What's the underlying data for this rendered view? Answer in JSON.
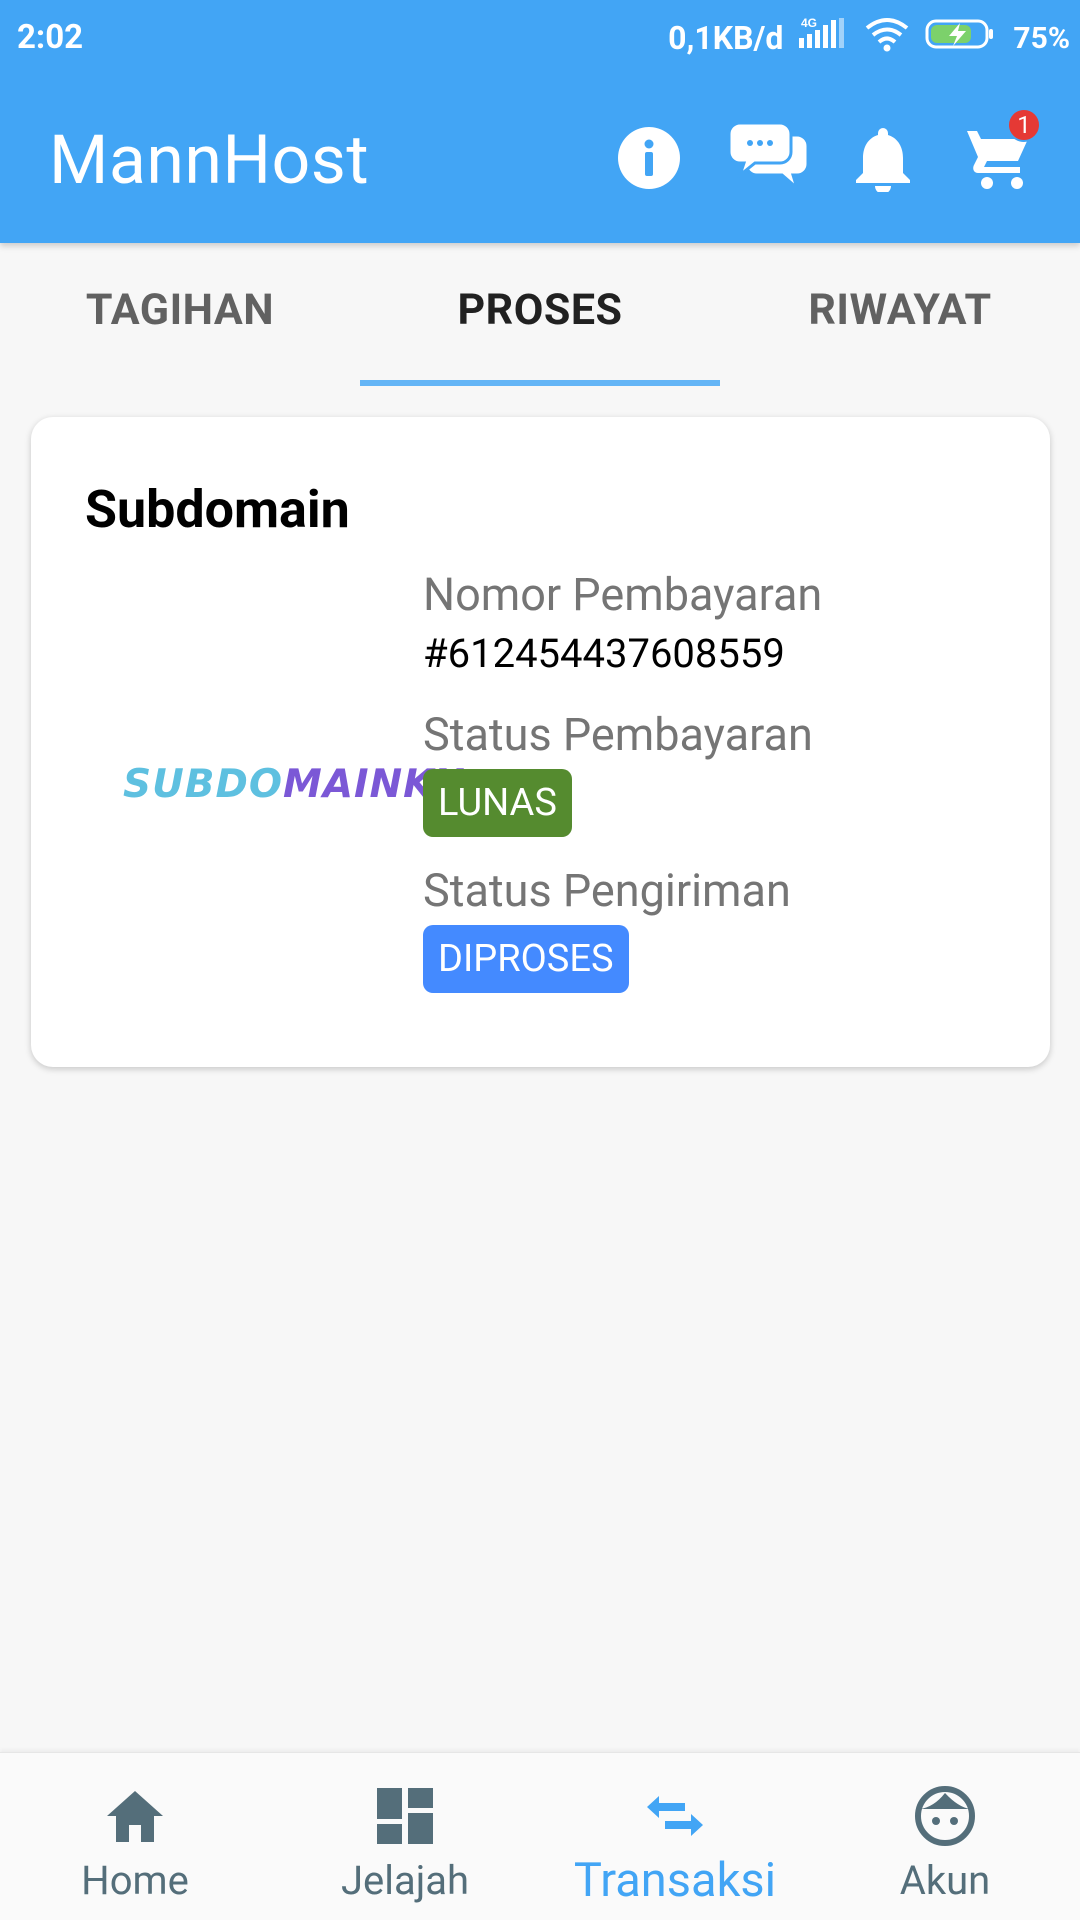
{
  "status_bar": {
    "time": "2:02",
    "network_speed": "0,1KB/d",
    "network_type": "4G",
    "battery_percent": "75%",
    "icons": [
      "signal-icon",
      "wifi-icon",
      "battery-charging-icon"
    ]
  },
  "app_bar": {
    "title": "MannHost",
    "cart_badge": "1",
    "icons": [
      "info-icon",
      "chat-icon",
      "bell-icon",
      "cart-icon"
    ]
  },
  "tabs": [
    {
      "label": "TAGIHAN",
      "active": false
    },
    {
      "label": "PROSES",
      "active": true
    },
    {
      "label": "RIWAYAT",
      "active": false
    }
  ],
  "card": {
    "title": "Subdomain",
    "logo_part1": "SUBDO",
    "logo_part2": "MAINKU",
    "payment_number_label": "Nomor Pembayaran",
    "payment_number": "#612454437608559",
    "payment_status_label": "Status Pembayaran",
    "payment_status": "LUNAS",
    "shipping_status_label": "Status Pengiriman",
    "shipping_status": "DIPROSES"
  },
  "bottom_nav": [
    {
      "label": "Home",
      "icon": "home-icon",
      "active": false
    },
    {
      "label": "Jelajah",
      "icon": "dashboard-icon",
      "active": false
    },
    {
      "label": "Transaksi",
      "icon": "swap-arrows-icon",
      "active": true
    },
    {
      "label": "Akun",
      "icon": "face-icon",
      "active": false
    }
  ],
  "colors": {
    "primary": "#42a5f5",
    "success": "#558b2f",
    "info": "#448aff",
    "badge": "#e53935"
  }
}
